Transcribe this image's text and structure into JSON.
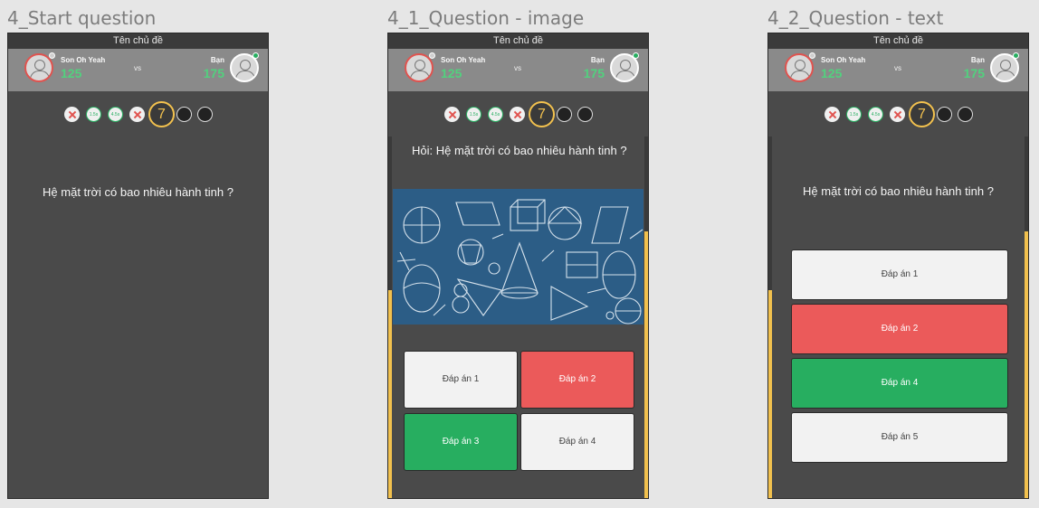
{
  "frames": [
    {
      "title": "4_Start question"
    },
    {
      "title": "4_1_Question - image"
    },
    {
      "title": "4_2_Question - text"
    }
  ],
  "topic": "Tên chủ đề",
  "players": {
    "left": {
      "name": "Son Oh Yeah",
      "score": "125"
    },
    "right": {
      "name": "Bạn",
      "score": "175"
    },
    "vs": "vs"
  },
  "progress": {
    "items": [
      "wrong",
      "1.5s",
      "4.5s",
      "wrong"
    ],
    "time_labels": {
      "t1": "1.5s",
      "t2": "4.5s"
    },
    "current": "7",
    "remaining": 2
  },
  "question": {
    "plain": "Hệ mặt trời có bao nhiêu hành tinh ?",
    "with_prefix": "Hỏi: Hệ mặt trời có bao nhiêu hành tinh ?"
  },
  "image_answers": [
    {
      "label": "Đáp án 1",
      "state": "neutral"
    },
    {
      "label": "Đáp án 2",
      "state": "wrong"
    },
    {
      "label": "Đáp án 3",
      "state": "correct"
    },
    {
      "label": "Đáp án 4",
      "state": "neutral"
    }
  ],
  "text_answers": [
    {
      "label": "Đáp án 1",
      "state": "neutral"
    },
    {
      "label": "Đáp án 2",
      "state": "wrong"
    },
    {
      "label": "Đáp án 4",
      "state": "correct"
    },
    {
      "label": "Đáp án 5",
      "state": "neutral"
    }
  ],
  "colors": {
    "wrong": "#eb5a5a",
    "correct": "#27ae60",
    "timer": "#f2c14e",
    "score": "#52d17e"
  }
}
